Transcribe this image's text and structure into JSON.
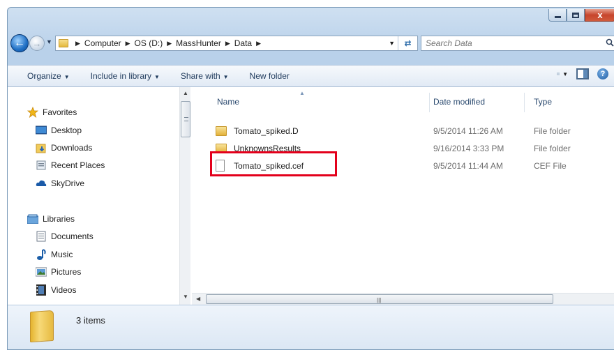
{
  "window": {
    "caption": {
      "minimize_icon": "minimize-icon",
      "maximize_icon": "maximize-icon",
      "close_glyph": "x"
    }
  },
  "address": {
    "crumbs": [
      "Computer",
      "OS (D:)",
      "MassHunter",
      "Data"
    ],
    "search_placeholder": "Search Data"
  },
  "toolbar": {
    "organize": "Organize",
    "include": "Include in library",
    "share": "Share with",
    "new_folder": "New folder"
  },
  "sidebar": {
    "favorites_header": "Favorites",
    "favorites": [
      "Desktop",
      "Downloads",
      "Recent Places",
      "SkyDrive"
    ],
    "libraries_header": "Libraries",
    "libraries": [
      "Documents",
      "Music",
      "Pictures",
      "Videos"
    ]
  },
  "columns": {
    "name": "Name",
    "date": "Date modified",
    "type": "Type"
  },
  "files": [
    {
      "name": "Tomato_spiked.D",
      "date": "9/5/2014 11:26 AM",
      "type": "File folder",
      "icon": "folder-icon"
    },
    {
      "name": "UnknownsResults",
      "date": "9/16/2014 3:33 PM",
      "type": "File folder",
      "icon": "folder-icon"
    },
    {
      "name": "Tomato_spiked.cef",
      "date": "9/5/2014 11:44 AM",
      "type": "CEF File",
      "icon": "file-icon"
    }
  ],
  "highlighted_file": "Tomato_spiked.cef",
  "colors": {
    "highlight_box": "#e3001b",
    "accent": "#2b4a6f"
  },
  "status": {
    "count": "3 items"
  }
}
